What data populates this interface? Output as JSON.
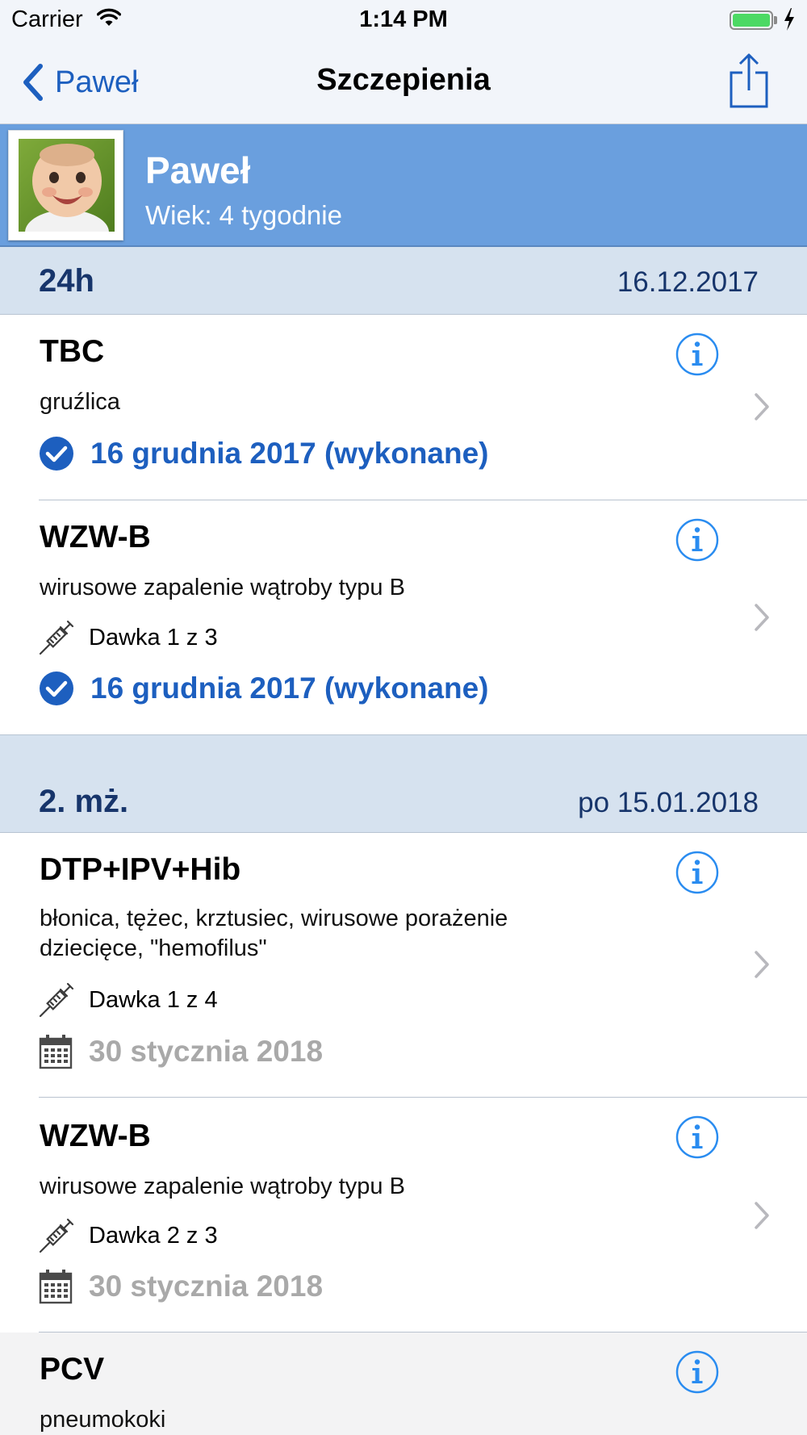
{
  "status_bar": {
    "carrier": "Carrier",
    "time": "1:14 PM"
  },
  "nav": {
    "back_label": "Paweł",
    "title": "Szczepienia"
  },
  "profile": {
    "name": "Paweł",
    "age": "Wiek: 4 tygodnie"
  },
  "colors": {
    "accent": "#1d5fbf",
    "header_blue": "#6a9fde",
    "section_bg": "#d6e2ef",
    "section_text": "#17356b",
    "pending_gray": "#a9a9a9",
    "info_blue": "#2a8cf0"
  },
  "sections": [
    {
      "label": "24h",
      "date": "16.12.2017",
      "items": [
        {
          "name": "TBC",
          "description": "gruźlica",
          "status": "16 grudnia 2017 (wykonane)",
          "status_kind": "done"
        },
        {
          "name": "WZW-B",
          "description": "wirusowe zapalenie wątroby typu B",
          "dose": "Dawka 1 z 3",
          "status": "16 grudnia 2017 (wykonane)",
          "status_kind": "done"
        }
      ]
    },
    {
      "label": "2. mż.",
      "date": "po 15.01.2018",
      "items": [
        {
          "name": "DTP+IPV+Hib",
          "description": "błonica, tężec, krztusiec, wirusowe porażenie dziecięce, \"hemofilus\"",
          "dose": "Dawka 1 z 4",
          "status": "30 stycznia 2018",
          "status_kind": "pending"
        },
        {
          "name": "WZW-B",
          "description": "wirusowe zapalenie wątroby typu B",
          "dose": "Dawka 2 z 3",
          "status": "30 stycznia 2018",
          "status_kind": "pending"
        },
        {
          "name": "PCV",
          "description": "pneumokoki"
        }
      ]
    }
  ]
}
